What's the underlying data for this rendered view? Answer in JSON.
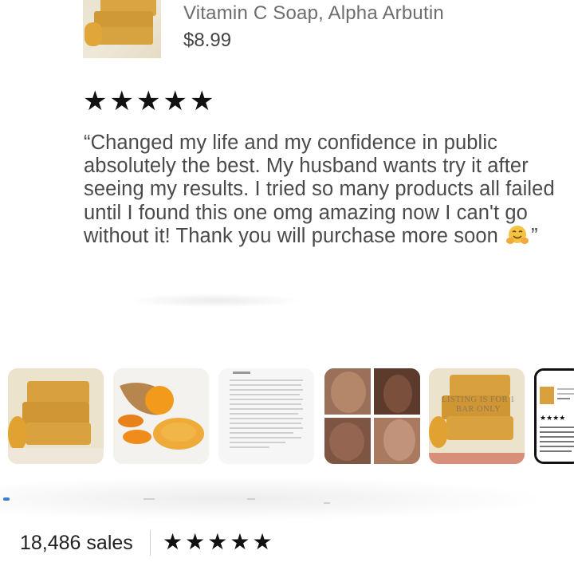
{
  "product": {
    "name": "Vitamin C Soap, Alpha Arbutin",
    "price": "$8.99",
    "thumbnail_icon": "soap-bars-image"
  },
  "review": {
    "rating": 5,
    "stars": [
      "★",
      "★",
      "★",
      "★",
      "★"
    ],
    "text_before_emoji": "“Changed my life and my confidence in public absolutely the best. My husband wants try it after seeing my results. I tried so many products all failed until I found this one omg amazing now I can't go without it! Thank you will purchase more soon ",
    "text_after_emoji": "”",
    "emoji_icon": "hugging-face-emoji"
  },
  "gallery": {
    "items": [
      {
        "icon": "soap-bars-photo"
      },
      {
        "icon": "turmeric-root-photo"
      },
      {
        "icon": "review-screenshot-photo"
      },
      {
        "icon": "skin-before-after-photo"
      },
      {
        "icon": "soap-bars-listing-photo",
        "overlay_text": "LISTING IS FOR 1 BAR ONLY"
      },
      {
        "icon": "review-card-photo",
        "selected": true
      }
    ]
  },
  "shop": {
    "sales": "18,486 sales",
    "rating": 5,
    "stars": [
      "★",
      "★",
      "★",
      "★",
      "★"
    ]
  },
  "colors": {
    "text_primary": "#222222",
    "text_secondary": "#6d6d6d",
    "review_text": "#4a4a4a",
    "soap_orange": "#d9a441"
  }
}
